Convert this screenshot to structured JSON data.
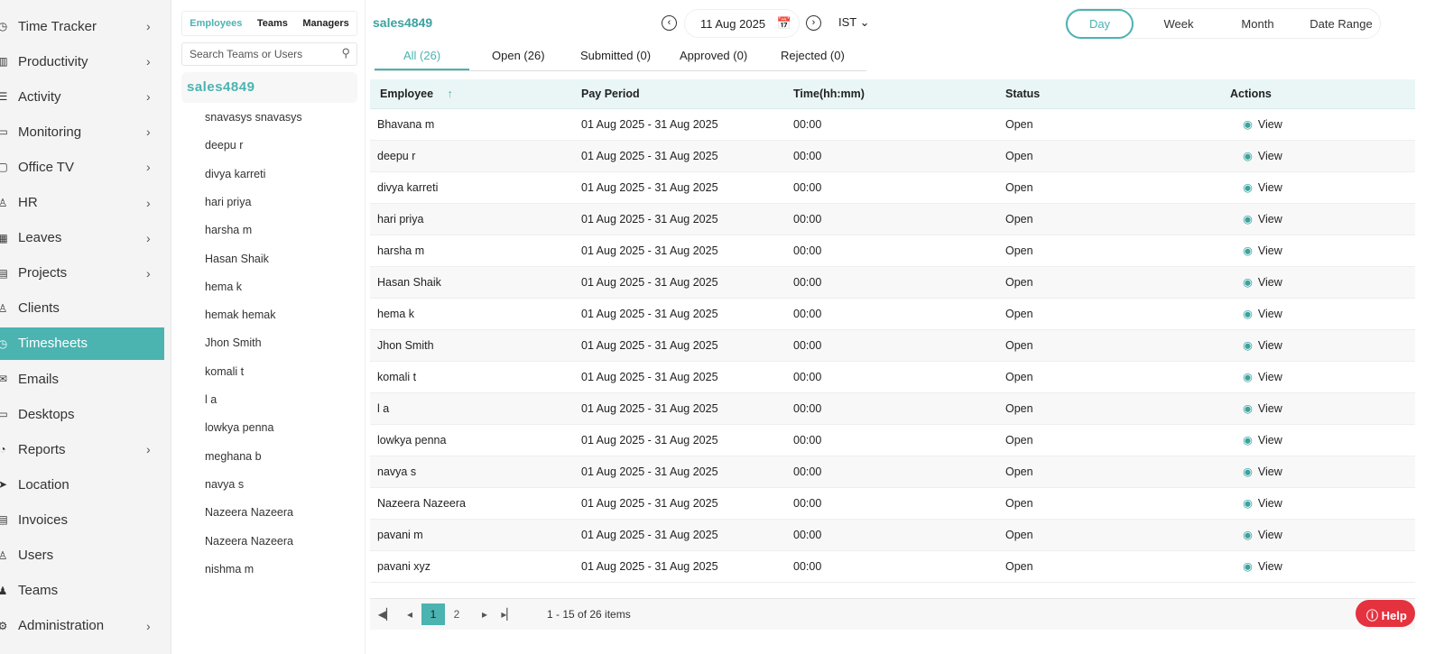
{
  "sidebar": {
    "items": [
      {
        "label": "Time Tracker",
        "icon": "timer-icon",
        "chev": true
      },
      {
        "label": "Productivity",
        "icon": "chart-icon",
        "chev": true
      },
      {
        "label": "Activity",
        "icon": "activity-icon",
        "chev": true
      },
      {
        "label": "Monitoring",
        "icon": "monitor-icon",
        "chev": true
      },
      {
        "label": "Office TV",
        "icon": "tv-icon",
        "chev": true
      },
      {
        "label": "HR",
        "icon": "hr-icon",
        "chev": true
      },
      {
        "label": "Leaves",
        "icon": "calendar-icon",
        "chev": true
      },
      {
        "label": "Projects",
        "icon": "projects-icon",
        "chev": true
      },
      {
        "label": "Clients",
        "icon": "client-icon",
        "chev": false
      },
      {
        "label": "Timesheets",
        "icon": "clock-icon",
        "chev": false,
        "active": true
      },
      {
        "label": "Emails",
        "icon": "mail-icon",
        "chev": false
      },
      {
        "label": "Desktops",
        "icon": "desktop-icon",
        "chev": false
      },
      {
        "label": "Reports",
        "icon": "reports-icon",
        "chev": true
      },
      {
        "label": "Location",
        "icon": "location-icon",
        "chev": false
      },
      {
        "label": "Invoices",
        "icon": "invoice-icon",
        "chev": false
      },
      {
        "label": "Users",
        "icon": "users-icon",
        "chev": false
      },
      {
        "label": "Teams",
        "icon": "teams-icon",
        "chev": false
      },
      {
        "label": "Administration",
        "icon": "admin-icon",
        "chev": true
      }
    ]
  },
  "panel": {
    "tabs": [
      "Employees",
      "Teams",
      "Managers"
    ],
    "search_placeholder": "Search Teams or Users",
    "team": "sales4849",
    "users": [
      "snavasys snavasys",
      "deepu r",
      "divya karreti",
      "hari priya",
      "harsha m",
      "Hasan Shaik",
      "hema k",
      "hemak hemak",
      "Jhon Smith",
      "komali t",
      "l a",
      "lowkya penna",
      "meghana b",
      "navya s",
      "Nazeera Nazeera",
      "Nazeera Nazeera",
      "nishma m"
    ]
  },
  "header": {
    "title": "sales4849",
    "date": "11 Aug 2025",
    "timezone": "IST",
    "ranges": [
      "Day",
      "Week",
      "Month",
      "Date Range"
    ],
    "active_range": "Day"
  },
  "status_tabs": [
    "All (26)",
    "Open (26)",
    "Submitted (0)",
    "Approved (0)",
    "Rejected (0)"
  ],
  "table": {
    "columns": [
      "Employee",
      "Pay Period",
      "Time(hh:mm)",
      "Status",
      "Actions"
    ],
    "sort_icon": "↑",
    "rows": [
      [
        "Bhavana m"
      ],
      [
        "deepu r"
      ],
      [
        "divya karreti"
      ],
      [
        "hari priya"
      ],
      [
        "harsha m"
      ],
      [
        "Hasan Shaik"
      ],
      [
        "hema k"
      ],
      [
        "Jhon Smith"
      ],
      [
        "komali t"
      ],
      [
        "l a"
      ],
      [
        "lowkya penna"
      ],
      [
        "navya s"
      ],
      [
        "Nazeera Nazeera"
      ],
      [
        "pavani m"
      ],
      [
        "pavani xyz"
      ]
    ],
    "pay_period": "01 Aug 2025 - 31 Aug 2025",
    "time": "00:00",
    "status": "Open",
    "action": "View"
  },
  "pager": {
    "pages": [
      "1",
      "2"
    ],
    "current": "1",
    "summary": "1 - 15 of 26 items"
  },
  "help": "Help",
  "colors": {
    "accent": "#4bb3b0",
    "help": "#e5323f"
  }
}
